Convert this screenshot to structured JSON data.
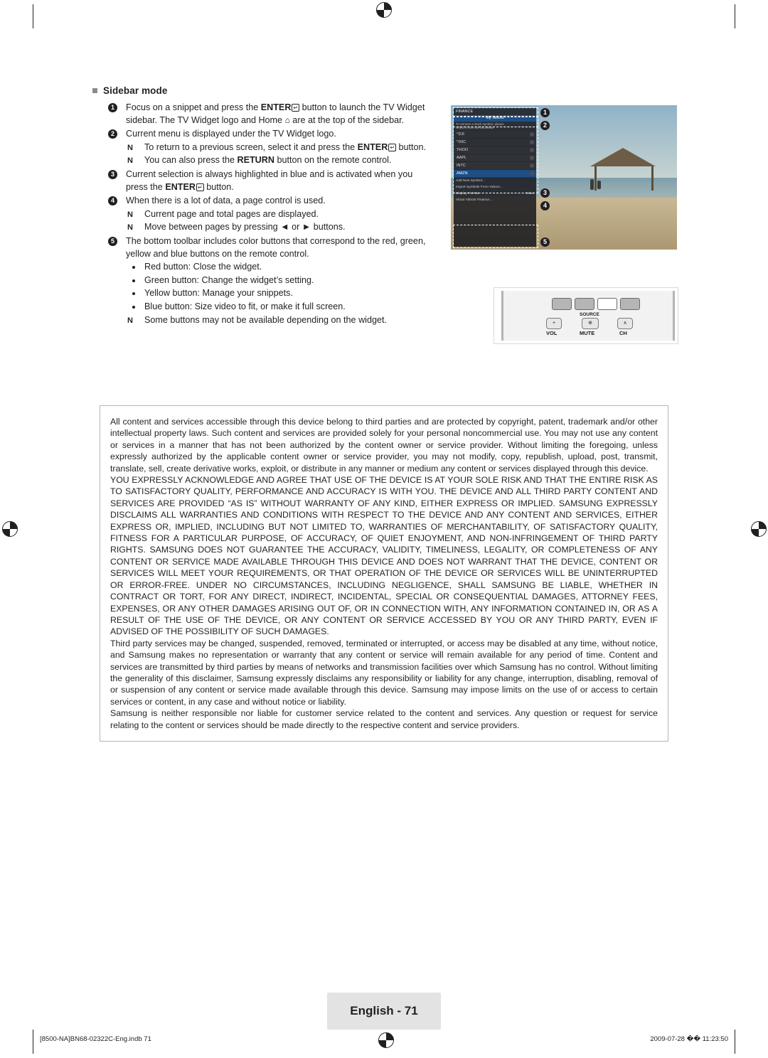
{
  "section": {
    "heading": "Sidebar mode"
  },
  "steps": [
    {
      "num": "1",
      "text_a": "Focus on a snippet and press the ",
      "bold_a": "ENTER",
      "key": "↵",
      "text_b": " button to launch the TV Widget sidebar. The TV Widget logo and Home ",
      "glyph": "⌂",
      "text_c": " are at the top of the sidebar."
    },
    {
      "num": "2",
      "text": "Current menu is displayed under the TV Widget logo.",
      "subs": [
        {
          "glyph": "N",
          "text_a": "To return to a previous screen, select it and press the ",
          "bold_a": "ENTER",
          "key": "↵",
          "text_b": " button."
        },
        {
          "glyph": "N",
          "text_a": "You can also press the ",
          "bold_a": "RETURN",
          "text_b": " button on the remote control."
        }
      ]
    },
    {
      "num": "3",
      "text_a": "Current selection is always highlighted in blue and is activated when you press the ",
      "bold_a": "ENTER",
      "key": "↵",
      "text_b": " button."
    },
    {
      "num": "4",
      "text": "When there is a lot of data, a page control is used.",
      "subs": [
        {
          "glyph": "N",
          "text_a": "Current page and total pages are displayed."
        },
        {
          "glyph": "N",
          "text_a": "Move between pages by pressing ◄ or ► buttons."
        }
      ]
    },
    {
      "num": "5",
      "text": "The bottom toolbar includes color buttons that correspond to the red, green, yellow and blue buttons on the remote control.",
      "bullets": [
        "Red button: Close the widget.",
        "Green button: Change the widget’s setting.",
        "Yellow button: Manage your snippets.",
        "Blue button: Size video to fit, or make it full screen."
      ],
      "subs": [
        {
          "glyph": "N",
          "text_a": "Some buttons may not be available depending on the widget."
        }
      ]
    }
  ],
  "tv_screenshot": {
    "title_bar": "FINANCE",
    "menu_label": "My Stocks",
    "note_line1": "To remove a stock symbol, please",
    "note_line2": "select it from the list below.",
    "rows": [
      {
        "label": "^DJI",
        "selected": false
      },
      {
        "label": "^IXIC",
        "selected": false
      },
      {
        "label": "YHOO",
        "selected": false
      },
      {
        "label": "AAPL",
        "selected": false
      },
      {
        "label": "INTC",
        "selected": false
      },
      {
        "label": "AMZN",
        "selected": false
      }
    ],
    "footer_items": [
      {
        "label": "Add New Symbol...",
        "value": ""
      },
      {
        "label": "Import Symbols From Yahoo!...",
        "value": ""
      },
      {
        "label": "Display Format",
        "value": "Value"
      },
      {
        "label": "About Yahoo! Finance...",
        "value": ""
      }
    ],
    "callouts": [
      "1",
      "2",
      "3",
      "4",
      "5"
    ]
  },
  "remote": {
    "source_label": "SOURCE",
    "vol_label": "VOL",
    "mute_label": "MUTE",
    "ch_label": "CH",
    "plus": "+",
    "up_chevron": "∧",
    "colors": [
      "#b5b5b5",
      "#b5b5b5",
      "#ffffff",
      "#b5b5b5"
    ]
  },
  "legal": {
    "paragraphs": [
      "All content and services accessible through this device belong to third parties and are protected by copyright, patent, trademark and/or other intellectual property laws. Such content and services are provided solely for your personal noncommercial use. You may not use any content or services in a manner that has not been authorized by the content owner or service provider. Without limiting the foregoing, unless expressly authorized by the applicable content owner or service provider, you may not modify, copy, republish, upload, post, transmit, translate, sell, create derivative works, exploit, or distribute in any manner or medium any content or services displayed through this device.",
      "YOU EXPRESSLY ACKNOWLEDGE AND AGREE THAT USE OF THE DEVICE IS AT YOUR SOLE RISK AND THAT THE ENTIRE RISK AS TO SATISFACTORY QUALITY, PERFORMANCE AND ACCURACY IS WITH YOU. THE DEVICE AND ALL THIRD PARTY CONTENT AND SERVICES ARE PROVIDED “AS IS” WITHOUT WARRANTY OF ANY KIND, EITHER EXPRESS OR IMPLIED. SAMSUNG EXPRESSLY DISCLAIMS ALL WARRANTIES AND CONDITIONS WITH RESPECT TO THE DEVICE AND ANY CONTENT AND SERVICES, EITHER EXPRESS OR, IMPLIED, INCLUDING BUT NOT LIMITED TO, WARRANTIES OF MERCHANTABILITY, OF SATISFACTORY QUALITY, FITNESS FOR A PARTICULAR PURPOSE, OF ACCURACY, OF QUIET ENJOYMENT, AND NON-INFRINGEMENT OF THIRD PARTY RIGHTS. SAMSUNG DOES NOT GUARANTEE THE ACCURACY, VALIDITY, TIMELINESS, LEGALITY, OR COMPLETENESS OF ANY CONTENT OR SERVICE MADE AVAILABLE THROUGH THIS DEVICE AND DOES NOT WARRANT THAT THE DEVICE, CONTENT OR SERVICES WILL MEET YOUR REQUIREMENTS, OR THAT OPERATION OF THE DEVICE OR SERVICES WILL BE UNINTERRUPTED OR ERROR-FREE. UNDER NO CIRCUMSTANCES, INCLUDING NEGLIGENCE, SHALL SAMSUNG BE LIABLE, WHETHER IN CONTRACT OR TORT, FOR ANY DIRECT, INDIRECT, INCIDENTAL, SPECIAL OR CONSEQUENTIAL DAMAGES, ATTORNEY FEES, EXPENSES, OR ANY OTHER DAMAGES ARISING OUT OF, OR IN CONNECTION WITH, ANY INFORMATION CONTAINED IN, OR AS A RESULT OF THE USE OF THE DEVICE, OR ANY CONTENT OR SERVICE ACCESSED BY YOU OR ANY THIRD PARTY, EVEN IF ADVISED OF THE POSSIBILITY OF SUCH DAMAGES.",
      "Third party services may be changed, suspended, removed, terminated or interrupted, or access may be disabled at any time, without notice, and Samsung makes no representation or warranty that any content or service will remain available for any period of time. Content and services are transmitted by third parties by means of networks and transmission facilities over which Samsung has no control. Without limiting the generality of this disclaimer, Samsung expressly disclaims any responsibility or liability for any change, interruption, disabling, removal of or suspension of any content or service made available through this device. Samsung may impose limits on the use of or access to certain services or content, in any case and without notice or liability.",
      "Samsung is neither responsible nor liable for customer service related to the content and services. Any question or request for service relating to the content or services should be made directly to the respective content and service providers."
    ]
  },
  "footer": {
    "page_label": "English - 71",
    "file_name": "[8500-NA]BN68-02322C-Eng.indb   71",
    "timestamp": "2009-07-28   �� 11:23:50"
  }
}
